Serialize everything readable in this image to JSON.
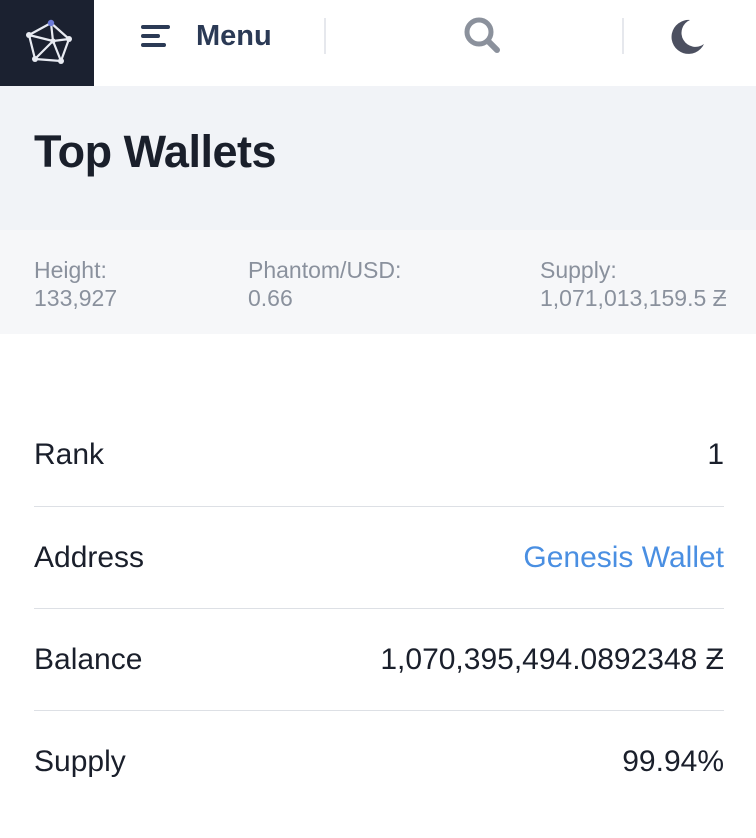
{
  "header": {
    "menu_label": "Menu",
    "logo_icon": "network-cube-icon",
    "menu_icon": "hamburger-menu-icon",
    "search_icon": "search-icon",
    "theme_icon": "moon-icon"
  },
  "page": {
    "title": "Top Wallets"
  },
  "stats": {
    "height_label": "Height:",
    "height_value": "133,927",
    "phantom_label": "Phantom/USD:",
    "phantom_value": "0.66",
    "supply_label": "Supply:",
    "supply_value": "1,071,013,159.5 Ƶ"
  },
  "wallet": {
    "rank_label": "Rank",
    "rank_value": "1",
    "address_label": "Address",
    "address_value": "Genesis Wallet",
    "balance_label": "Balance",
    "balance_value": "1,070,395,494.0892348 Ƶ",
    "supply_label": "Supply",
    "supply_value": "99.94%"
  },
  "colors": {
    "logo_bg": "#1b2130",
    "link": "#4a8fe2",
    "title_band": "#f1f3f7",
    "stats_band": "#f6f7f9"
  }
}
